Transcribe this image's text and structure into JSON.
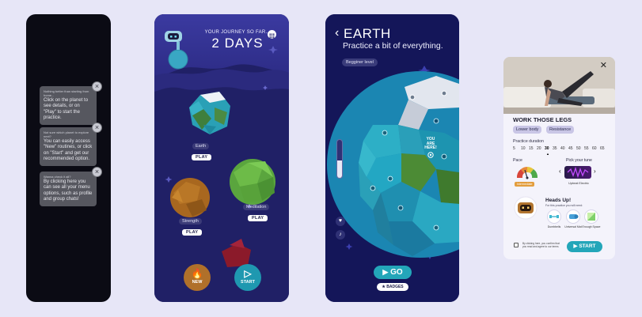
{
  "screen1": {
    "tips": [
      {
        "small": "Nothing better than starting from home...",
        "main": "Click on the planet to see details, or on \"Play\" to start the practice."
      },
      {
        "small": "Not sure which planet to explore next?",
        "main": "You can easily access \"New\" routines, or click on \"Start\" and get our recommended option."
      },
      {
        "small": "Wanna check it all?",
        "main": "By clicking here you can see all your menu options, such as profile and group chats!"
      }
    ]
  },
  "screen2": {
    "journey_label": "YOUR JOURNEY SO FAR...",
    "days": "2 DAYS",
    "planets": [
      {
        "label": "Earth",
        "play": "PLAY"
      },
      {
        "label": "Meditation",
        "play": "PLAY"
      },
      {
        "label": "Strength",
        "play": "PLAY"
      }
    ],
    "new_label": "NEW",
    "start_label": "START"
  },
  "screen3": {
    "back": "‹",
    "title": "EARTH",
    "subtitle": "Practice a bit of everything.",
    "level": "Begginer level",
    "you_are_here": "YOU ARE HERE!",
    "slider_level": 0.45,
    "go": "GO",
    "badges": "BADGES"
  },
  "screen4": {
    "title": "WORK THOSE LEGS",
    "chips": [
      "Lower body",
      "Resistance"
    ],
    "duration_label": "Practice duration",
    "durations": [
      "5",
      "10",
      "15",
      "20",
      "30",
      "35",
      "40",
      "45",
      "50",
      "55",
      "60",
      "65"
    ],
    "selected_duration": "30",
    "pace_label": "Pace",
    "pace_value": "Intermediate",
    "tune_label": "Pick your tune",
    "tune_value": "Upbeat Electric",
    "heads_up": "Heads Up!",
    "heads_up_sub": "For this practice you will need:",
    "equipment": [
      "Dumbbells",
      "Universal Mat",
      "Enough Space"
    ],
    "terms": "By clicking here, you confirm that you read and agree to our terms",
    "start": "START"
  },
  "colors": {
    "accent": "#23a6b9",
    "navy": "#24246a",
    "bg": "#e7e6f7"
  }
}
